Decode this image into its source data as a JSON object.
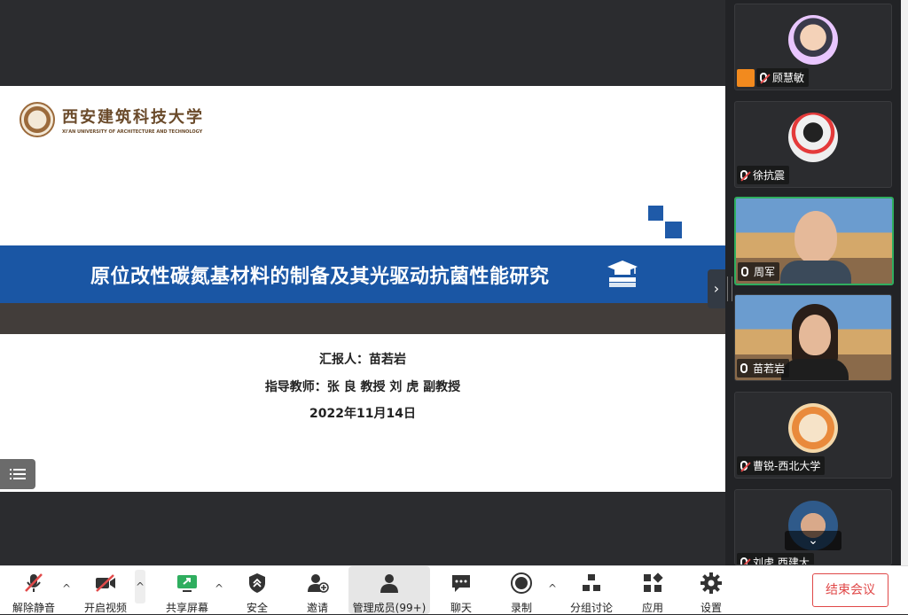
{
  "slide": {
    "logo_cn": "西安建筑科技大学",
    "logo_en": "XI'AN UNIVERSITY OF ARCHITECTURE AND TECHNOLOGY",
    "title": "原位改性碳氮基材料的制备及其光驱动抗菌性能研究",
    "reporter": "汇报人：苗若岩",
    "advisor": "指导教师：张 良 教授 刘 虎 副教授",
    "date": "2022年11月14日"
  },
  "participants": [
    {
      "name": "顾慧敏",
      "muted": true,
      "video": false
    },
    {
      "name": "徐抗震",
      "muted": true,
      "video": false
    },
    {
      "name": "周军",
      "muted": false,
      "video": true,
      "active": true
    },
    {
      "name": "苗若岩",
      "muted": false,
      "video": true
    },
    {
      "name": "曹锐-西北大学",
      "muted": true,
      "video": false
    },
    {
      "name": "刘虎 西建大",
      "muted": true,
      "video": true
    }
  ],
  "toolbar": {
    "unmute": "解除静音",
    "start_video": "开启视频",
    "share_screen": "共享屏幕",
    "security": "安全",
    "invite": "邀请",
    "manage_members": "管理成员(99+)",
    "chat": "聊天",
    "record": "录制",
    "breakout": "分组讨论",
    "apps": "应用",
    "settings": "设置",
    "end_meeting": "结束会议"
  },
  "colors": {
    "title_bar": "#1a56a4",
    "active_border": "#2fae5f",
    "end_button": "#e04848"
  }
}
